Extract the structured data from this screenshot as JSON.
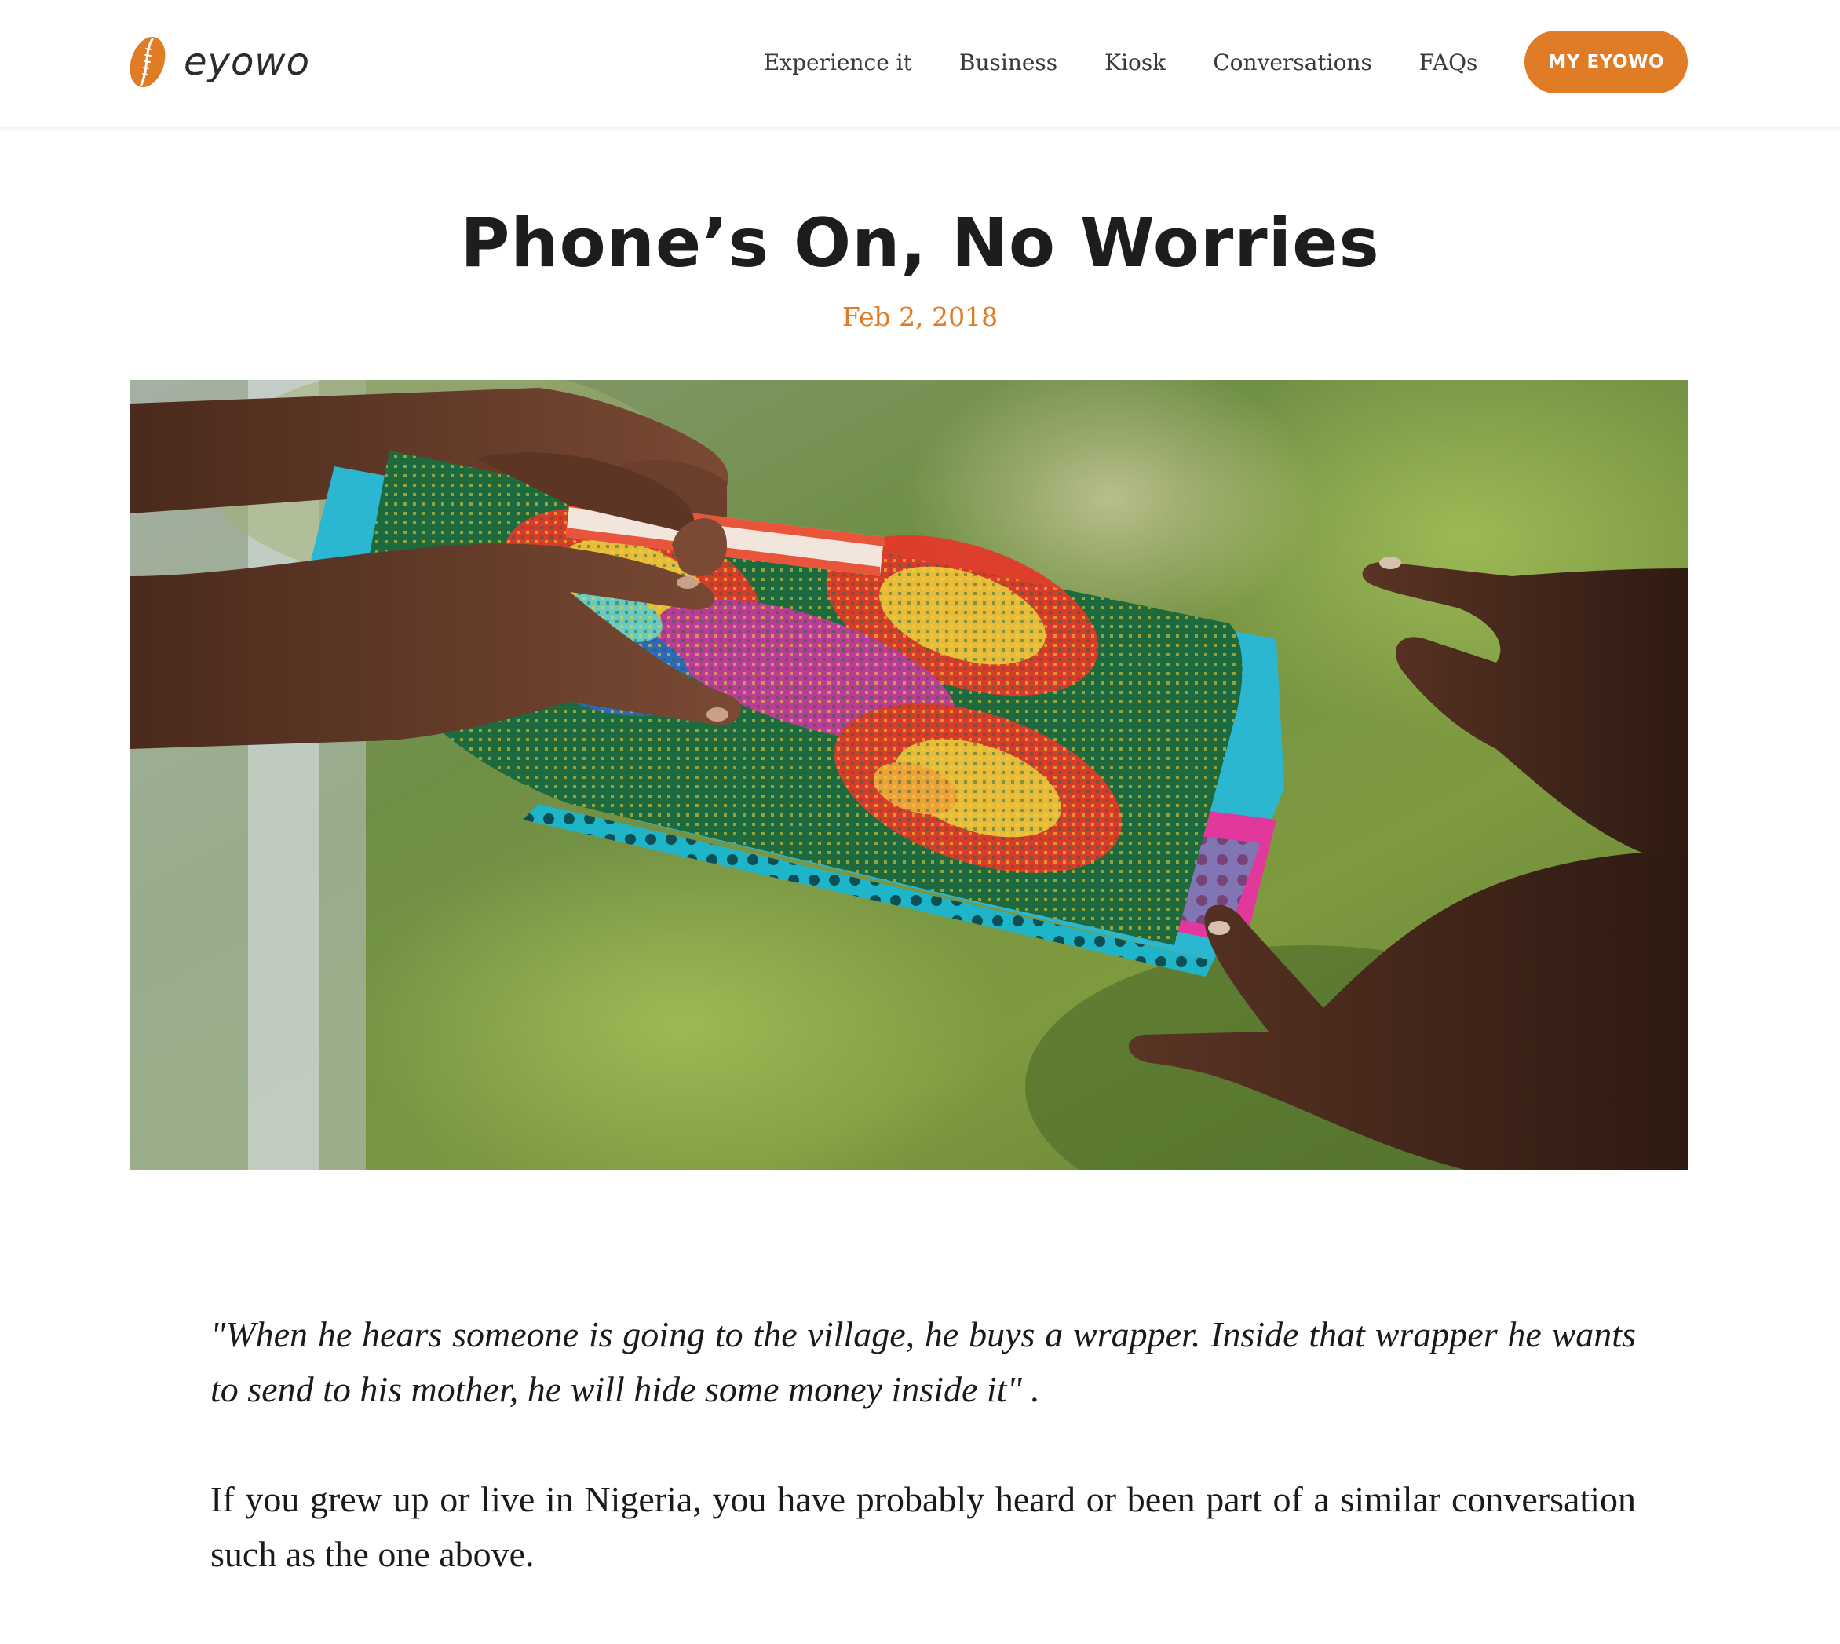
{
  "header": {
    "logo_text": "eyowo",
    "nav": [
      {
        "label": "Experience it"
      },
      {
        "label": "Business"
      },
      {
        "label": "Kiosk"
      },
      {
        "label": "Conversations"
      },
      {
        "label": "FAQs"
      }
    ],
    "cta_label": "MY EYOWO"
  },
  "post": {
    "title": "Phone’s On, No Worries",
    "date": "Feb 2, 2018",
    "hero_alt": "",
    "quote": "\"When he hears someone is going to the village, he buys a wrapper. Inside that wrapper he wants to send to his mother, he will hide some money inside it\" .",
    "paragraph_1": "If you grew up or live in Nigeria, you have probably heard or been part of a similar conversation such as the one above."
  },
  "colors": {
    "accent": "#e07c26",
    "title": "#1f1d1c",
    "text": "#1a1a1a"
  },
  "icons": {
    "logo": "cowrie-shell-icon"
  }
}
